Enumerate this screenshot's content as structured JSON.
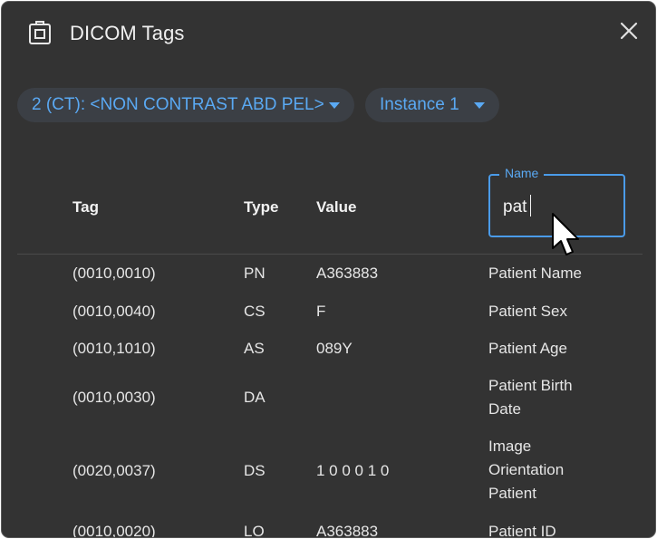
{
  "dialog": {
    "title": "DICOM Tags",
    "icon": "dicom-tag-icon",
    "close_icon": "close-icon"
  },
  "selectors": {
    "series": "2 (CT): <NON CONTRAST ABD PEL>",
    "instance": "Instance 1"
  },
  "table": {
    "headers": {
      "tag": "Tag",
      "type": "Type",
      "value": "Value"
    },
    "filter": {
      "label": "Name",
      "value": "pat"
    },
    "rows": [
      {
        "tag": "(0010,0010)",
        "type": "PN",
        "value": "A363883",
        "name": "Patient Name"
      },
      {
        "tag": "(0010,0040)",
        "type": "CS",
        "value": "F",
        "name": "Patient Sex"
      },
      {
        "tag": "(0010,1010)",
        "type": "AS",
        "value": "089Y",
        "name": "Patient Age"
      },
      {
        "tag": "(0010,0030)",
        "type": "DA",
        "value": "",
        "name": "Patient Birth Date"
      },
      {
        "tag": "(0020,0037)",
        "type": "DS",
        "value": "1 0 0 0 1 0",
        "name": "Image Orientation Patient"
      },
      {
        "tag": "(0010,0020)",
        "type": "LO",
        "value": "A363883",
        "name": "Patient ID"
      }
    ]
  },
  "colors": {
    "background": "#333333",
    "accent": "#5aa9f3",
    "chip": "#3b3f45"
  }
}
